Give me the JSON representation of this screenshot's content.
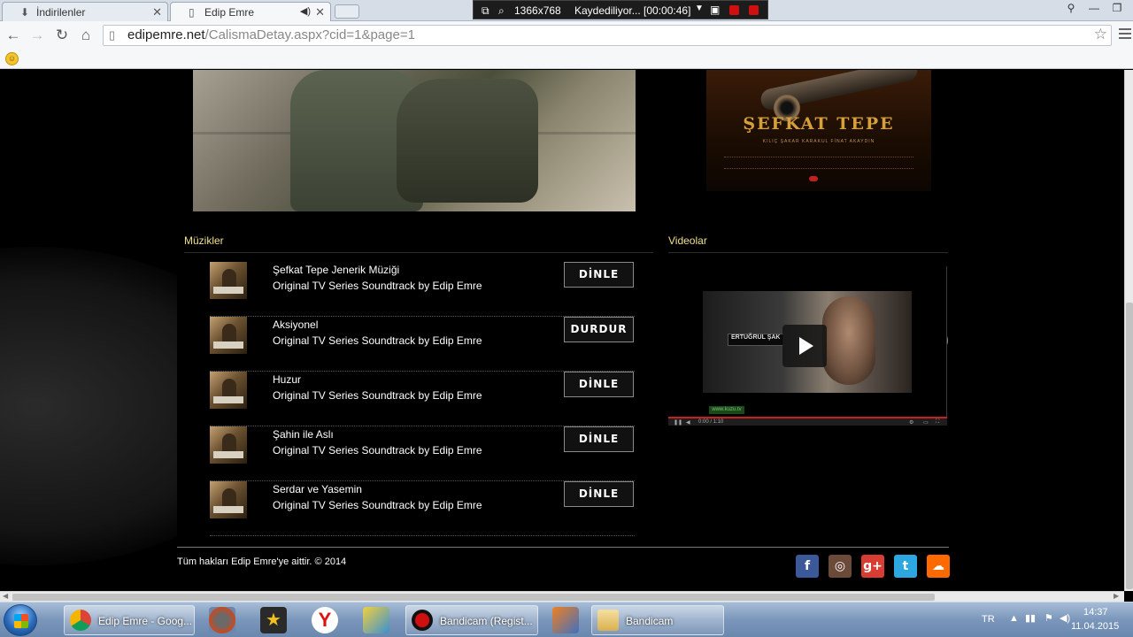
{
  "browser": {
    "tabs": [
      {
        "label": "İndirilenler",
        "icon": "download-icon"
      },
      {
        "label": "Edip Emre",
        "icon": "page-icon",
        "active": true
      }
    ],
    "url": {
      "host": "edipemre.net",
      "path": "/CalismaDetay.aspx?cid=1&page=1"
    }
  },
  "recorder": {
    "resolution": "1366x768",
    "status": "Kaydediliyor... [00:00:46]"
  },
  "poster": {
    "title": "ŞEFKAT TEPE",
    "names": "KILIÇ  ŞAKAR  KARAKUL  FİNAT  AKAYDIN"
  },
  "music": {
    "heading": "Müzikler",
    "tracks": [
      {
        "title": "Şefkat Tepe Jenerik Müziği",
        "subtitle": "Original TV Series Soundtrack by Edip Emre",
        "button": "DİNLE"
      },
      {
        "title": "Aksiyonel",
        "subtitle": "Original TV Series Soundtrack by Edip Emre",
        "button": "DURDUR"
      },
      {
        "title": "Huzur",
        "subtitle": "Original TV Series Soundtrack by Edip Emre",
        "button": "DİNLE"
      },
      {
        "title": "Şahin ile Aslı",
        "subtitle": "Original TV Series Soundtrack by Edip Emre",
        "button": "DİNLE"
      },
      {
        "title": "Serdar ve Yasemin",
        "subtitle": "Original TV Series Soundtrack by Edip Emre",
        "button": "DİNLE"
      }
    ]
  },
  "videos": {
    "heading": "Videolar",
    "caption": "ERTUĞRUL ŞAK",
    "link": "www.kuzu.tv",
    "time": "0:00 / 1:10",
    "prev": "‹",
    "next": "›"
  },
  "footer": {
    "copyright": "Tüm hakları Edip Emre'ye aittir. © 2014",
    "social": [
      {
        "name": "facebook",
        "glyph": "f",
        "color": "#3b5998"
      },
      {
        "name": "instagram",
        "glyph": "◎",
        "color": "#6b4a3a"
      },
      {
        "name": "google-plus",
        "glyph": "g+",
        "color": "#d73d32"
      },
      {
        "name": "twitter",
        "glyph": "t",
        "color": "#2ca7e0"
      },
      {
        "name": "soundcloud",
        "glyph": "☁",
        "color": "#ff6a00"
      }
    ]
  },
  "taskbar": {
    "buttons": [
      {
        "label": "Edip Emre - Goog...",
        "color": "#e8a42a"
      },
      {
        "label": "Bandicam (Regist...",
        "color": "#c01010"
      },
      {
        "label": "Bandicam",
        "color": "#e8c868"
      }
    ],
    "lang": "TR",
    "time": "14:37",
    "date": "11.04.2015"
  }
}
